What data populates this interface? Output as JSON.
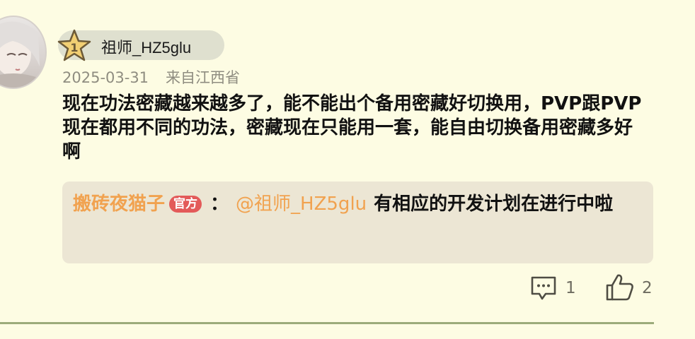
{
  "user": {
    "name": "祖师_HZ5glu",
    "level": "1",
    "date": "2025-03-31",
    "location": "来自江西省"
  },
  "comment": {
    "text": "现在功法密藏越来越多了，能不能出个备用密藏好切换用，PVP跟PVP现在都用不同的功法，密藏现在只能用一套，能自由切换备用密藏多好啊"
  },
  "reply": {
    "author": "搬砖夜猫子",
    "badge": "官方",
    "separator": "：",
    "mention": "@祖师_HZ5glu",
    "text": "有相应的开发计划在进行中啦"
  },
  "actions": {
    "comment_count": "1",
    "like_count": "2"
  },
  "colors": {
    "background": "#fdfce3",
    "accent": "#f1a24f",
    "official": "#e35a59"
  }
}
